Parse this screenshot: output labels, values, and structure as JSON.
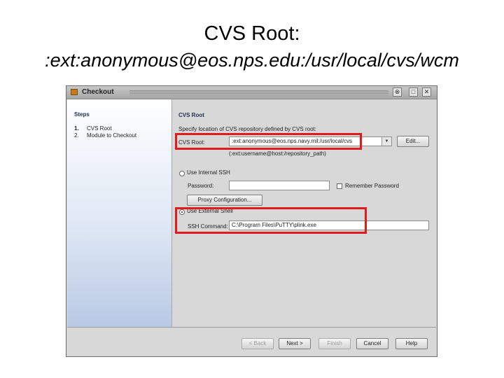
{
  "slide": {
    "title": "CVS Root:",
    "subtitle": ":ext:anonymous@eos.nps.edu:/usr/local/cvs/wcm"
  },
  "window": {
    "title": "Checkout",
    "controls": [
      "⊗",
      "□",
      "✕"
    ]
  },
  "steps": {
    "heading": "Steps",
    "items": [
      {
        "num": "1.",
        "label": "CVS Root"
      },
      {
        "num": "2.",
        "label": "Module to Checkout"
      }
    ]
  },
  "cvs_root": {
    "heading": "CVS Root",
    "description": "Specify location of CVS repository defined by CVS root:",
    "root_label": "CVS Root:",
    "root_value": ":ext:anonymous@eos.nps.navy.mil:/usr/local/cvs",
    "edit_label": "Edit...",
    "hint": "(:ext:username@host:/repository_path)"
  },
  "ssh": {
    "internal_label": "Use Internal SSH",
    "password_label": "Password:",
    "password_value": "",
    "remember_label": "Remember Password",
    "proxy_label": "Proxy Configuration...",
    "external_label": "Use External Shell",
    "command_label": "SSH Command:",
    "command_value": "C:\\Program Files\\PuTTY\\plink.exe"
  },
  "footer": {
    "back": "< Back",
    "next": "Next >",
    "finish": "Finish",
    "cancel": "Cancel",
    "help": "Help"
  },
  "colors": {
    "highlight": "#e01b1b"
  }
}
